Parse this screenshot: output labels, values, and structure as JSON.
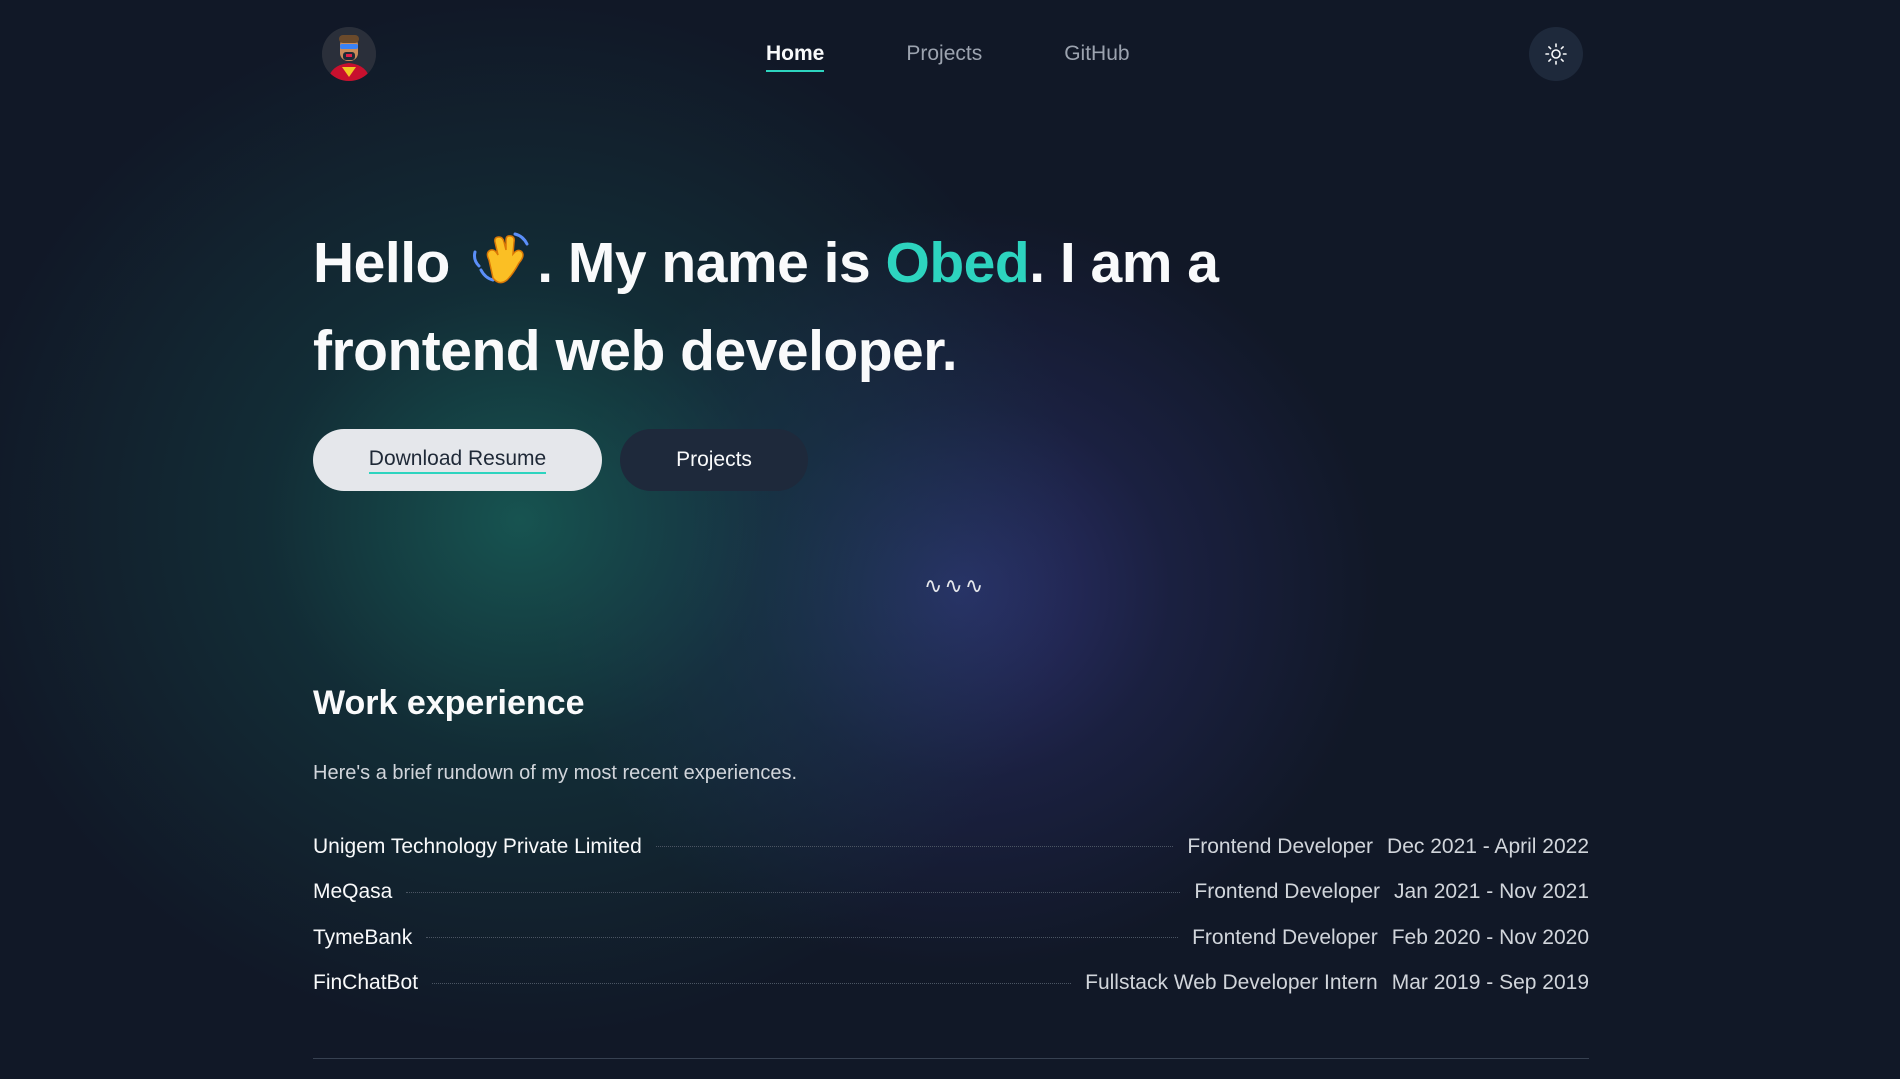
{
  "nav": {
    "items": [
      {
        "label": "Home",
        "active": true
      },
      {
        "label": "Projects",
        "active": false
      },
      {
        "label": "GitHub",
        "active": false
      }
    ],
    "theme_toggle_icon": "sun-icon"
  },
  "hero": {
    "greeting": "Hello",
    "wave_icon": "waving-hand-icon",
    "text_before_name": ". My name is ",
    "name": "Obed",
    "text_after_name": ". I am a",
    "line2": "frontend web developer.",
    "accent_color": "#2dd4bf"
  },
  "buttons": {
    "resume_label": "Download Resume",
    "projects_label": "Projects"
  },
  "squiggle": "∿∿∿",
  "work": {
    "title": "Work experience",
    "subtitle": "Here's a brief rundown of my most recent experiences.",
    "items": [
      {
        "company": "Unigem Technology Private Limited",
        "role": "Frontend Developer",
        "dates": "Dec 2021 - April 2022"
      },
      {
        "company": "MeQasa",
        "role": "Frontend Developer",
        "dates": "Jan 2021 - Nov 2021"
      },
      {
        "company": "TymeBank",
        "role": "Frontend Developer",
        "dates": "Feb 2020 - Nov 2020"
      },
      {
        "company": "FinChatBot",
        "role": "Fullstack Web Developer Intern",
        "dates": "Mar 2019 - Sep 2019"
      }
    ]
  }
}
